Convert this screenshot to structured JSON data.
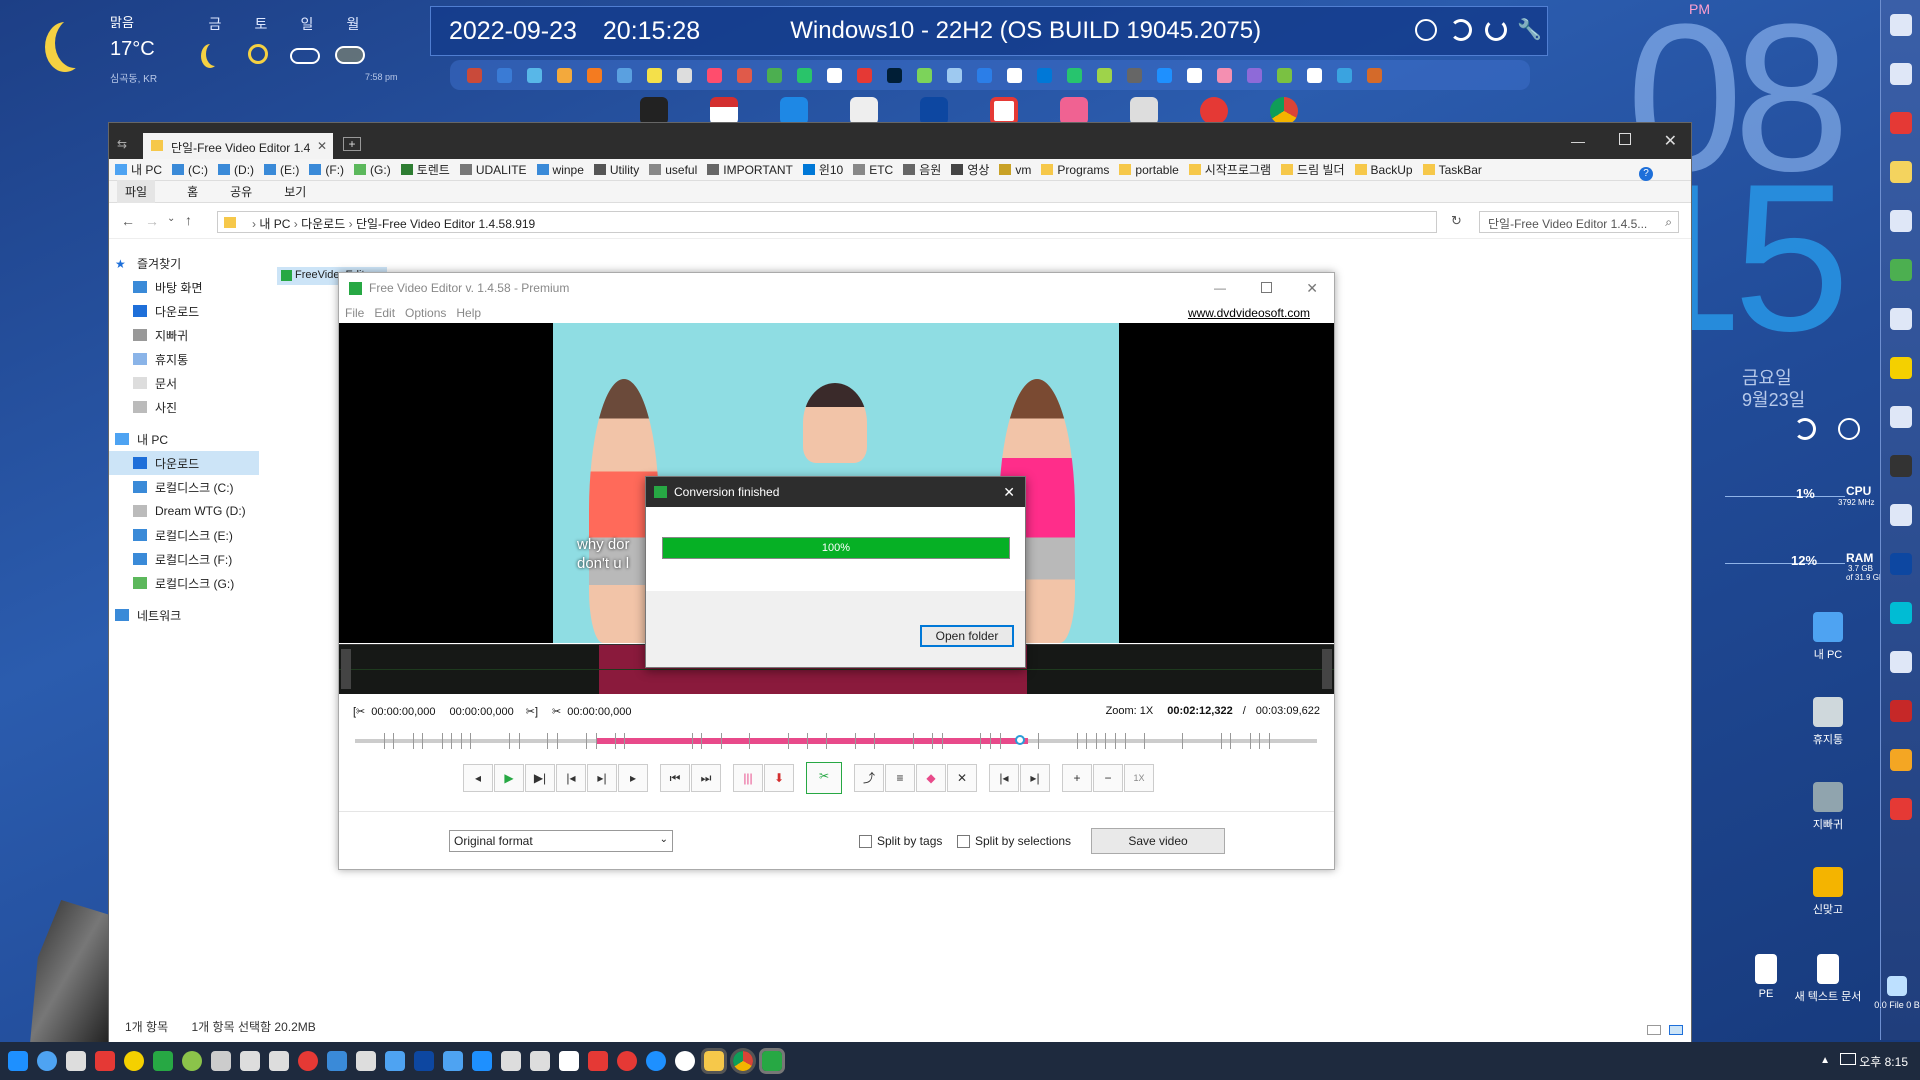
{
  "weather": {
    "condition": "맑음",
    "temp": "17°C",
    "location": "심곡동, KR",
    "days": [
      "금",
      "토",
      "일",
      "월"
    ],
    "updated": "7:58 pm"
  },
  "topbar": {
    "date": "2022-09-23",
    "time": "20:15:28",
    "os": "Windows10 - 22H2 (OS BUILD 19045.2075)"
  },
  "clock": {
    "ampm": "PM",
    "hour": "08",
    "minute": "15",
    "weekday": "금요일",
    "date": "9월23일"
  },
  "sysmon": {
    "cpu_label": "CPU",
    "cpu_pct": "1%",
    "cpu_freq": "3792 MHz",
    "ram_label": "RAM",
    "ram_pct": "12%",
    "ram_used": "3.7 GB",
    "ram_total": "of 31.9 GB"
  },
  "explorer": {
    "tab_title": "단일-Free Video Editor 1.4",
    "bookmarks": [
      "내 PC",
      "(C:)",
      "(D:)",
      "(E:)",
      "(F:)",
      "(G:)",
      "토렌트",
      "UDALITE",
      "winpe",
      "Utility",
      "useful",
      "IMPORTANT",
      "윈10",
      "ETC",
      "음원",
      "영상",
      "vm",
      "Programs",
      "portable",
      "시작프로그램",
      "드림 빌더",
      "BackUp",
      "TaskBar"
    ],
    "ribbon": [
      "파일",
      "홈",
      "공유",
      "보기"
    ],
    "breadcrumb": [
      "내 PC",
      "다운로드",
      "단일-Free Video Editor 1.4.58.919"
    ],
    "search_placeholder": "단일-Free Video Editor 1.4.5...",
    "nav": {
      "favorites": "즐겨찾기",
      "fav_items": [
        "바탕 화면",
        "다운로드",
        "지빠귀",
        "휴지통",
        "문서",
        "사진"
      ],
      "this_pc": "내 PC",
      "pc_items": [
        "다운로드",
        "로컬디스크 (C:)",
        "Dream WTG (D:)",
        "로컬디스크 (E:)",
        "로컬디스크 (F:)",
        "로컬디스크 (G:)"
      ],
      "network": "네트워크"
    },
    "file_item": "FreeVideoEditor",
    "status_count": "1개 항목",
    "status_selected": "1개 항목 선택함 20.2MB"
  },
  "fve": {
    "title": "Free Video Editor v. 1.4.58 - Premium",
    "menu": [
      "File",
      "Edit",
      "Options",
      "Help"
    ],
    "link": "www.dvdvideosoft.com",
    "subtitle_line1": "why dor",
    "subtitle_line2": "don't u l",
    "sel_start": "00:00:00,000",
    "sel_end": "00:00:00,000",
    "sel_len": "00:00:00,000",
    "zoom_label": "Zoom: 1X",
    "current_time": "00:02:12,322",
    "total_time": "00:03:09,622",
    "zoom_btn": "1X",
    "format": "Original format",
    "split_tags": "Split by tags",
    "split_selections": "Split by selections",
    "save": "Save video",
    "selection_fraction_start": 0.25,
    "selection_fraction_end": 0.7
  },
  "dialog": {
    "title": "Conversion finished",
    "progress": "100%",
    "progress_value": 1.0,
    "button": "Open folder"
  },
  "desktop_icons": [
    "내 PC",
    "휴지통",
    "지빠귀",
    "신맞고",
    "PE",
    "새 텍스트 문서",
    "0.0 File 0 B"
  ],
  "taskbar": {
    "time": "오후 8:15"
  }
}
